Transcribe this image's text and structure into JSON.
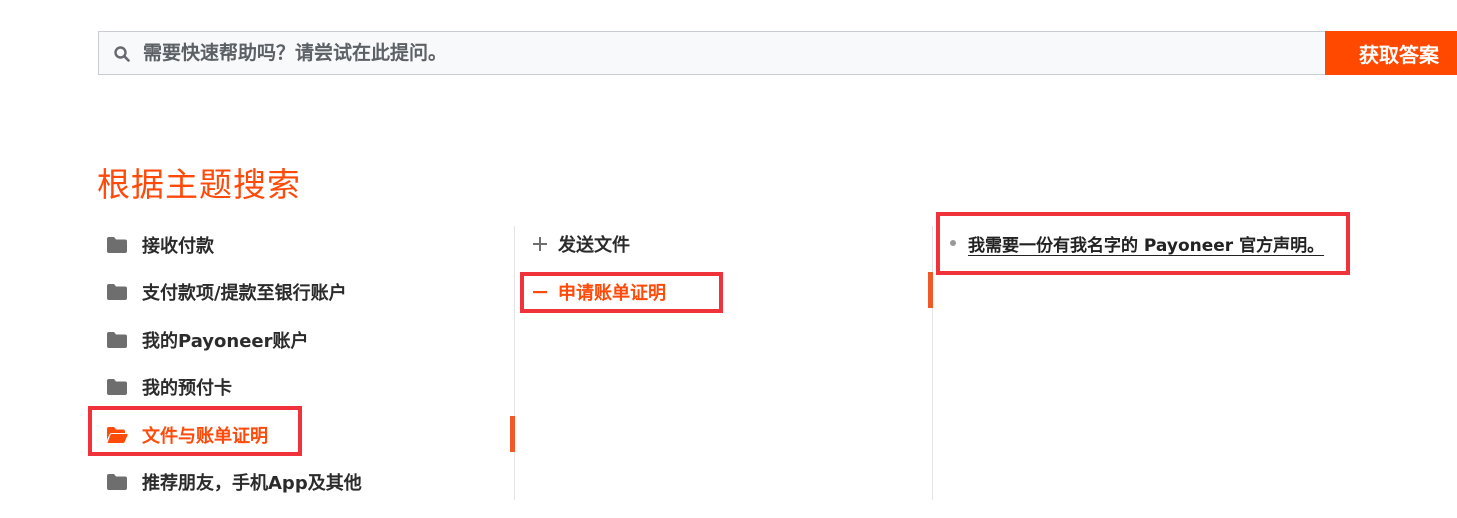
{
  "search": {
    "placeholder": "需要快速帮助吗？请尝试在此提问。",
    "button_label": "获取答案"
  },
  "section_title": "根据主题搜索",
  "categories": [
    {
      "label": "接收付款",
      "icon": "folder-icon"
    },
    {
      "label": "支付款项/提款至银行账户",
      "icon": "folder-icon"
    },
    {
      "label": "我的Payoneer账户",
      "icon": "folder-icon"
    },
    {
      "label": "我的预付卡",
      "icon": "folder-icon"
    },
    {
      "label": "文件与账单证明",
      "icon": "folder-open-icon",
      "active": true
    },
    {
      "label": "推荐朋友，手机App及其他",
      "icon": "folder-icon"
    }
  ],
  "subcategories": [
    {
      "label": "发送文件",
      "icon": "plus-icon"
    },
    {
      "label": "申请账单证明",
      "icon": "minus-icon",
      "active": true
    }
  ],
  "articles": [
    {
      "label": "我需要一份有我名字的 Payoneer 官方声明。"
    }
  ],
  "colors": {
    "accent": "#ff4800",
    "active_text": "#ff4a0a",
    "highlight_box": "#f0333a"
  }
}
